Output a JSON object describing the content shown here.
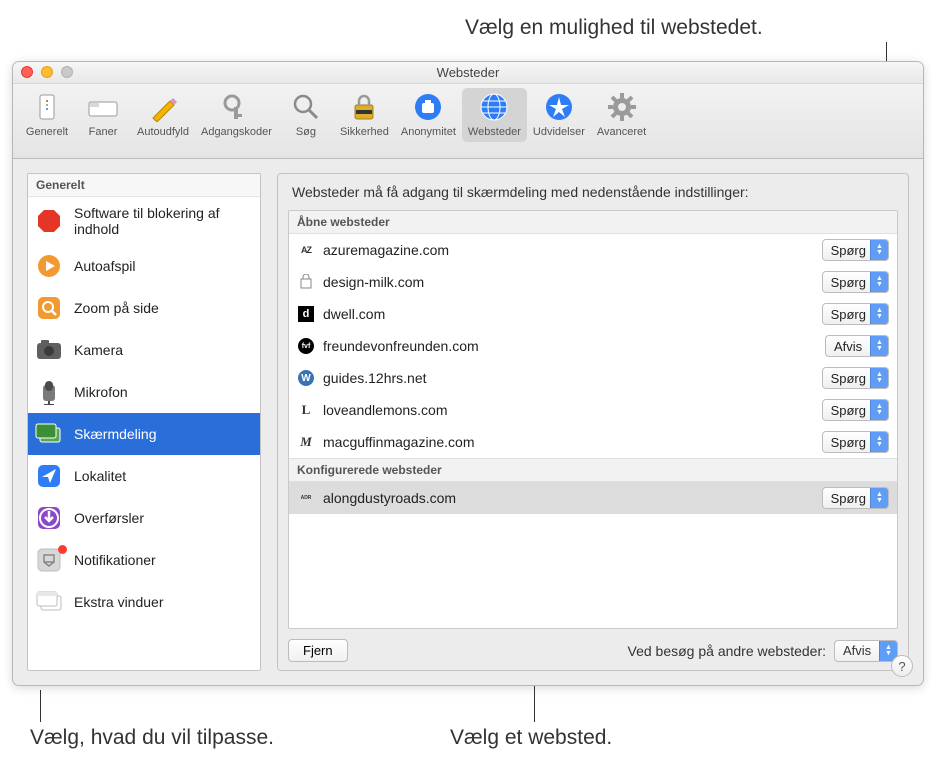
{
  "callouts": {
    "top": "Vælg en mulighed til webstedet.",
    "bottom_left": "Vælg, hvad du vil tilpasse.",
    "bottom_right": "Vælg et websted."
  },
  "window": {
    "title": "Websteder"
  },
  "toolbar": {
    "items": [
      {
        "label": "Generelt",
        "icon": "general"
      },
      {
        "label": "Faner",
        "icon": "tabs"
      },
      {
        "label": "Autoudfyld",
        "icon": "autofill"
      },
      {
        "label": "Adgangskoder",
        "icon": "passwords"
      },
      {
        "label": "Søg",
        "icon": "search"
      },
      {
        "label": "Sikkerhed",
        "icon": "security"
      },
      {
        "label": "Anonymitet",
        "icon": "privacy"
      },
      {
        "label": "Websteder",
        "icon": "websites",
        "selected": true
      },
      {
        "label": "Udvidelser",
        "icon": "extensions"
      },
      {
        "label": "Avanceret",
        "icon": "advanced"
      }
    ]
  },
  "sidebar": {
    "header": "Generelt",
    "items": [
      {
        "label": "Software til blokering af indhold",
        "icon": "stop"
      },
      {
        "label": "Autoafspil",
        "icon": "play"
      },
      {
        "label": "Zoom på side",
        "icon": "zoom"
      },
      {
        "label": "Kamera",
        "icon": "camera"
      },
      {
        "label": "Mikrofon",
        "icon": "mic"
      },
      {
        "label": "Skærmdeling",
        "icon": "screenshare",
        "selected": true
      },
      {
        "label": "Lokalitet",
        "icon": "location"
      },
      {
        "label": "Overførsler",
        "icon": "downloads"
      },
      {
        "label": "Notifikationer",
        "icon": "notifications",
        "dot": true
      },
      {
        "label": "Ekstra vinduer",
        "icon": "popups"
      }
    ]
  },
  "panel": {
    "caption": "Websteder må få adgang til skærmdeling med nedenstående indstillinger:",
    "open_header": "Åbne websteder",
    "open_sites": [
      {
        "name": "azuremagazine.com",
        "option": "Spørg",
        "favicon": "AZ"
      },
      {
        "name": "design-milk.com",
        "option": "Spørg",
        "favicon": "bag"
      },
      {
        "name": "dwell.com",
        "option": "Spørg",
        "favicon": "d"
      },
      {
        "name": "freundevonfreunden.com",
        "option": "Afvis",
        "favicon": "fvf"
      },
      {
        "name": "guides.12hrs.net",
        "option": "Spørg",
        "favicon": "w"
      },
      {
        "name": "loveandlemons.com",
        "option": "Spørg",
        "favicon": "L"
      },
      {
        "name": "macguffinmagazine.com",
        "option": "Spørg",
        "favicon": "M"
      }
    ],
    "configured_header": "Konfigurerede websteder",
    "configured_sites": [
      {
        "name": "alongdustyroads.com",
        "option": "Spørg",
        "favicon": "adr",
        "selected": true
      }
    ],
    "remove_label": "Fjern",
    "other_label": "Ved besøg på andre websteder:",
    "other_value": "Afvis",
    "help": "?"
  }
}
